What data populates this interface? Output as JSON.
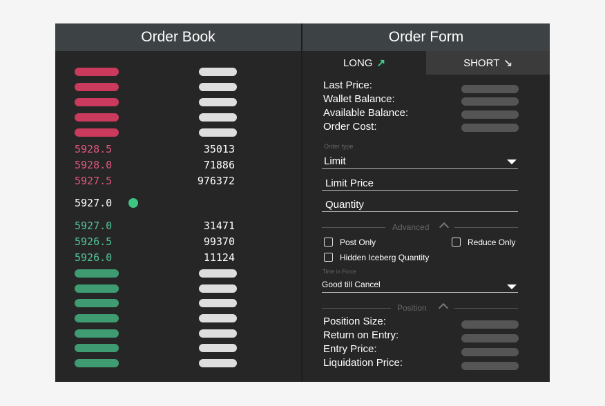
{
  "order_book": {
    "title": "Order Book",
    "asks": [
      {
        "price": "5928.5",
        "size": "35013"
      },
      {
        "price": "5928.0",
        "size": "71886"
      },
      {
        "price": "5927.5",
        "size": "976372"
      }
    ],
    "mid_price": "5927.0",
    "bids": [
      {
        "price": "5927.0",
        "size": "31471"
      },
      {
        "price": "5926.5",
        "size": "99370"
      },
      {
        "price": "5926.0",
        "size": "11124"
      }
    ]
  },
  "order_form": {
    "title": "Order Form",
    "tabs": {
      "long": "LONG",
      "short": "SHORT"
    },
    "info_labels": [
      "Last Price:",
      "Wallet Balance:",
      "Available Balance:",
      "Order Cost:"
    ],
    "order_type_label": "Order type",
    "order_type_value": "Limit",
    "limit_price_placeholder": "Limit Price",
    "quantity_placeholder": "Quantity",
    "advanced_label": "Advanced",
    "post_only": "Post Only",
    "reduce_only": "Reduce Only",
    "hidden_iceberg": "Hidden Iceberg Quantity",
    "time_in_force_label": "Time in Force",
    "time_in_force_value": "Good till Cancel",
    "position_label": "Position",
    "position_labels": [
      "Position Size:",
      "Return on Entry:",
      "Entry Price:",
      "Liquidation Price:"
    ]
  },
  "colors": {
    "ask": "#e0577d",
    "bid": "#52c497",
    "header": "#3d4245",
    "background": "#262626"
  },
  "icons": {
    "long_arrow": "arrow-up-right-icon",
    "short_arrow": "arrow-down-right-icon"
  }
}
